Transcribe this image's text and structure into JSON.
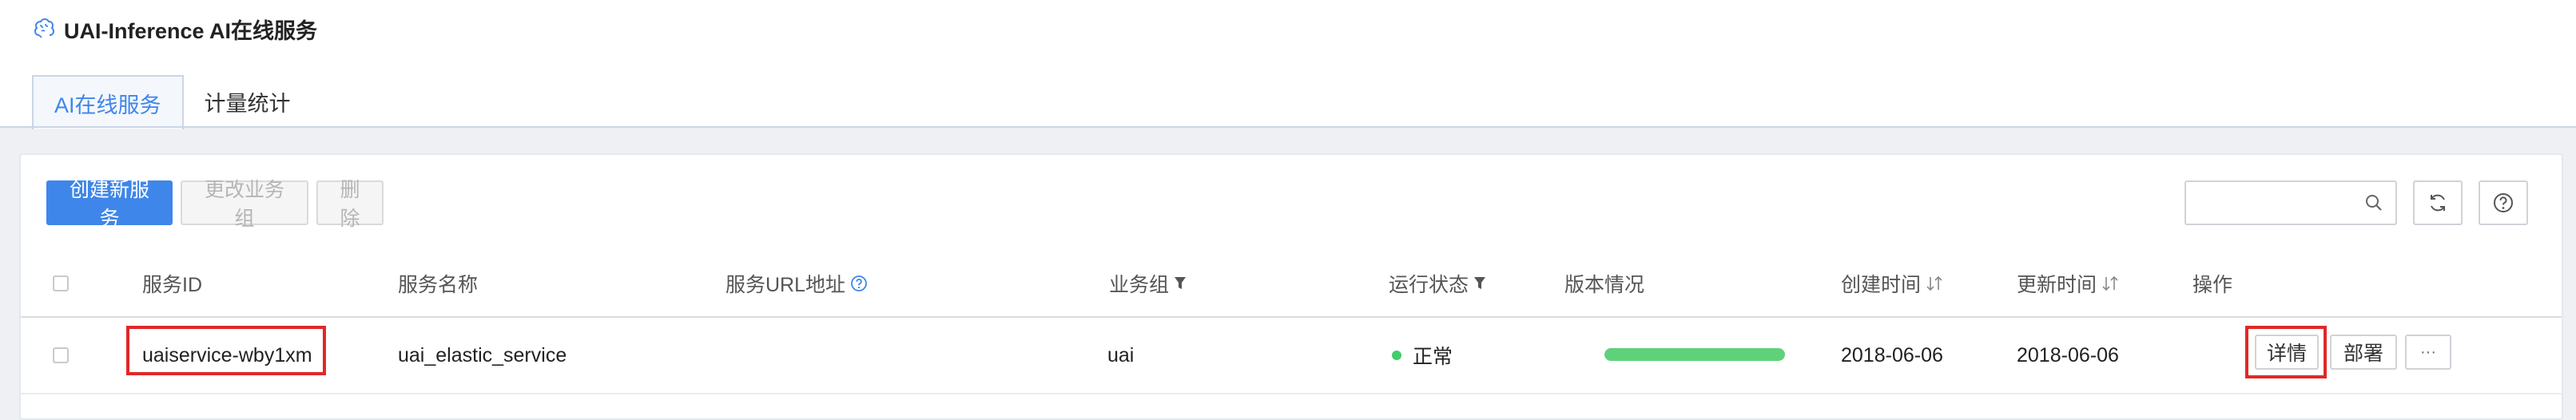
{
  "app": {
    "title": "UAI-Inference AI在线服务"
  },
  "tabs": [
    {
      "label": "AI在线服务",
      "active": true
    },
    {
      "label": "计量统计",
      "active": false
    }
  ],
  "toolbar": {
    "create_label": "创建新服务",
    "change_group_label": "更改业务组",
    "delete_label": "删除",
    "search_value": "",
    "search_placeholder": ""
  },
  "table": {
    "columns": [
      "服务ID",
      "服务名称",
      "服务URL地址",
      "业务组",
      "运行状态",
      "版本情况",
      "创建时间",
      "更新时间",
      "操作"
    ],
    "rows": [
      {
        "id": "uaiservice-wby1xm",
        "name": "uai_elastic_service",
        "url": "",
        "group": "uai",
        "status": "正常",
        "version_progress": 1.0,
        "created": "2018-06-06",
        "updated": "2018-06-06",
        "actions": {
          "detail": "详情",
          "deploy": "部署",
          "more": "···"
        }
      }
    ]
  },
  "colors": {
    "primary": "#3f86ea",
    "status_ok": "#3fcf6c",
    "progress": "#5ed27a",
    "highlight": "#e02828"
  }
}
